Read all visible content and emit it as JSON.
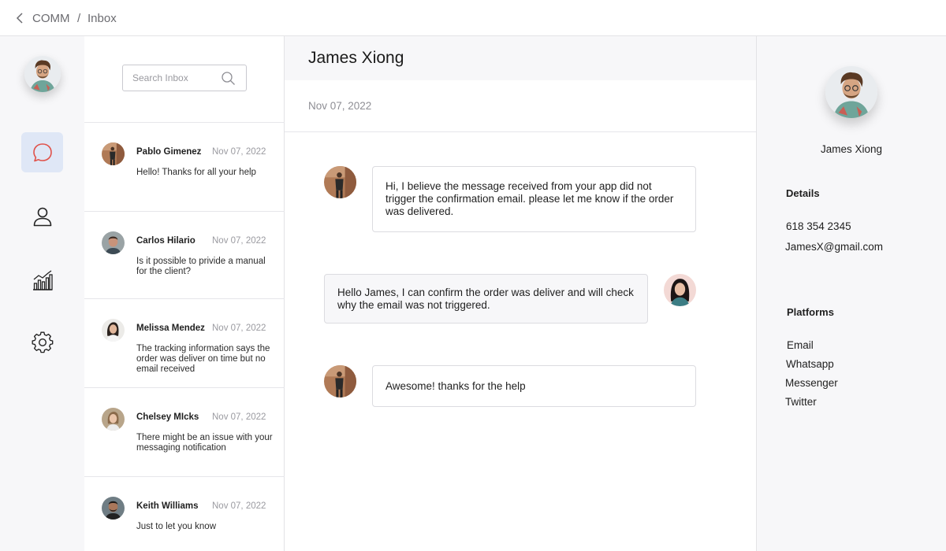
{
  "breadcrumb": {
    "app": "COMM",
    "separator": "/",
    "page": "Inbox"
  },
  "colors": {
    "accent": "#e0524a",
    "active_nav_bg": "#dfe7f6",
    "panel_bg": "#f7f7f9",
    "border": "#e3e3e6"
  },
  "sidebar": {
    "nav": [
      {
        "icon": "chat-bubble-icon",
        "active": true
      },
      {
        "icon": "user-icon",
        "active": false
      },
      {
        "icon": "analytics-chart-icon",
        "active": false
      },
      {
        "icon": "settings-gear-icon",
        "active": false
      }
    ]
  },
  "inbox": {
    "search": {
      "placeholder": "Search Inbox",
      "value": ""
    },
    "conversations": [
      {
        "name": "Pablo Gimenez",
        "date": "Nov 07, 2022",
        "preview": "Hello! Thanks for all your help"
      },
      {
        "name": "Carlos Hilario",
        "date": "Nov 07, 2022",
        "preview": "Is it possible to privide a manual for the client?"
      },
      {
        "name": "Melissa Mendez",
        "date": "Nov 07, 2022",
        "preview": "The tracking information says the order was deliver on time but no email received"
      },
      {
        "name": "Chelsey MIcks",
        "date": "Nov 07, 2022",
        "preview": "There might be an issue with your messaging notification"
      },
      {
        "name": "Keith Williams",
        "date": "Nov 07, 2022",
        "preview": "Just to let you know"
      }
    ]
  },
  "chat": {
    "contact_name": "James Xiong",
    "date": "Nov 07, 2022",
    "messages": [
      {
        "direction": "incoming",
        "text": "Hi, I believe the message received from your app did not trigger the confirmation email. please let me know if the order was delivered."
      },
      {
        "direction": "outgoing",
        "text": "Hello James, I can confirm the order was deliver and will check why the email was not triggered."
      },
      {
        "direction": "incoming",
        "text": "Awesome! thanks for the help"
      }
    ]
  },
  "details": {
    "name": "James Xiong",
    "details_heading": "Details",
    "phone": "618 354 2345",
    "email": "JamesX@gmail.com",
    "platforms_heading": "Platforms",
    "platforms": [
      "Email",
      "Whatsapp",
      "Messenger",
      "Twitter"
    ]
  }
}
